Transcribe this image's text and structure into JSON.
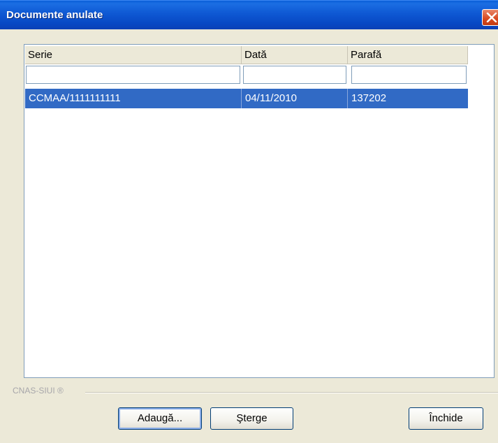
{
  "window": {
    "title": "Documente anulate",
    "close_icon": "close-icon"
  },
  "table": {
    "columns": [
      "Serie",
      "Dată",
      "Parafă"
    ],
    "filters": [
      "",
      "",
      ""
    ],
    "rows": [
      {
        "serie": "CCMAA/1111111111",
        "data": "04/11/2010",
        "parafa": "137202",
        "selected": true
      }
    ]
  },
  "footer": {
    "label": "CNAS-SIUI ®"
  },
  "buttons": {
    "add": "Adaugă...",
    "delete": "Şterge",
    "close": "Închide"
  },
  "colors": {
    "title_bar": "#0a5fd8",
    "selection": "#316ac5",
    "close_button": "#d7481f"
  }
}
